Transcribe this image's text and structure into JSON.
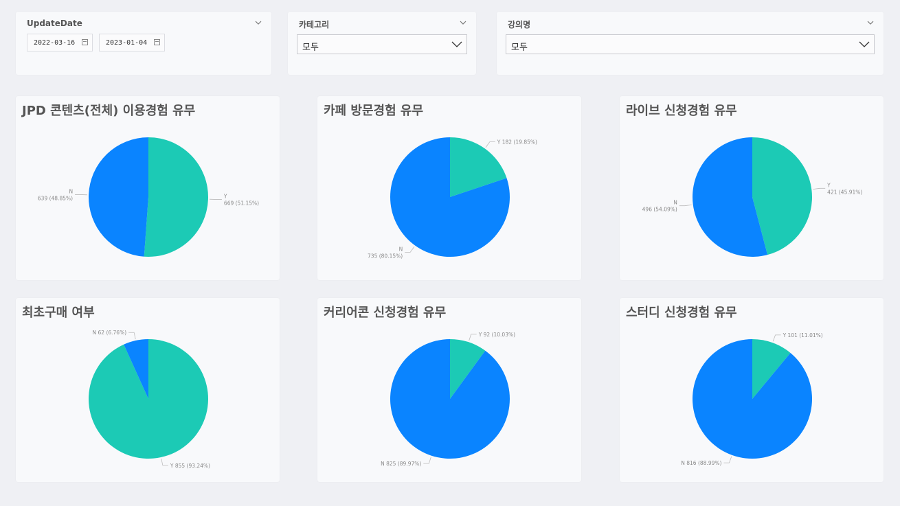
{
  "slicers": {
    "date": {
      "label": "UpdateDate",
      "start": "2022-03-16",
      "end": "2023-01-04"
    },
    "category": {
      "label": "카테고리",
      "value": "모두"
    },
    "course": {
      "label": "강의명",
      "value": "모두"
    }
  },
  "colors": {
    "Y": "#1ccab5",
    "N": "#0a84ff"
  },
  "chart_data": [
    {
      "type": "pie",
      "title": "JPD 콘텐츠(전체) 이용경험 유무",
      "slices": [
        {
          "name": "Y",
          "value": 669,
          "pct": "51.15%",
          "label": "Y\n669 (51.15%)"
        },
        {
          "name": "N",
          "value": 639,
          "pct": "48.85%",
          "label": "N\n639 (48.85%)"
        }
      ]
    },
    {
      "type": "pie",
      "title": "카페 방문경험 유무",
      "slices": [
        {
          "name": "Y",
          "value": 182,
          "pct": "19.85%",
          "label": "Y 182 (19.85%)"
        },
        {
          "name": "N",
          "value": 735,
          "pct": "80.15%",
          "label": "N\n735 (80.15%)"
        }
      ]
    },
    {
      "type": "pie",
      "title": "라이브 신청경험 유무",
      "slices": [
        {
          "name": "Y",
          "value": 421,
          "pct": "45.91%",
          "label": "Y\n421 (45.91%)"
        },
        {
          "name": "N",
          "value": 496,
          "pct": "54.09%",
          "label": "N\n496 (54.09%)"
        }
      ]
    },
    {
      "type": "pie",
      "title": "최초구매 여부",
      "slices": [
        {
          "name": "Y",
          "value": 855,
          "pct": "93.24%",
          "label": "Y 855 (93.24%)"
        },
        {
          "name": "N",
          "value": 62,
          "pct": "6.76%",
          "label": "N 62 (6.76%)"
        }
      ]
    },
    {
      "type": "pie",
      "title": "커리어콘 신청경험 유무",
      "slices": [
        {
          "name": "Y",
          "value": 92,
          "pct": "10.03%",
          "label": "Y 92 (10.03%)"
        },
        {
          "name": "N",
          "value": 825,
          "pct": "89.97%",
          "label": "N 825 (89.97%)"
        }
      ]
    },
    {
      "type": "pie",
      "title": "스터디 신청경험 유무",
      "slices": [
        {
          "name": "Y",
          "value": 101,
          "pct": "11.01%",
          "label": "Y 101 (11.01%)"
        },
        {
          "name": "N",
          "value": 816,
          "pct": "88.99%",
          "label": "N 816 (88.99%)"
        }
      ]
    }
  ]
}
